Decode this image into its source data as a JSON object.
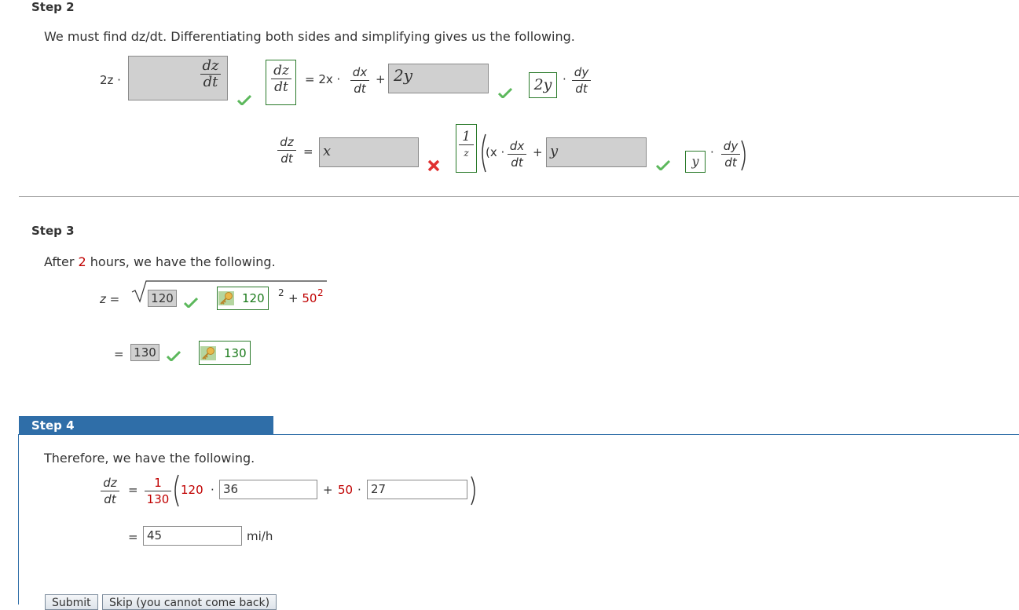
{
  "step2": {
    "label": "Step 2",
    "intro": "We must find dz/dt. Differentiating both sides and simplifying gives us the following.",
    "row1": {
      "coef_left": "2z ·",
      "box1_value": "dz/dt",
      "answer1_num": "dz",
      "answer1_den": "dt",
      "eq_mid": "= 2x ·",
      "dx_num": "dx",
      "dx_den": "dt",
      "plus": "+",
      "box2_value": "2y",
      "answer2": "2y",
      "dot": "·",
      "dy_num": "dy",
      "dy_den": "dt"
    },
    "row2": {
      "dz_num": "dz",
      "dz_den": "dt",
      "eq": "=",
      "box1_value": "x",
      "answer1_num": "1",
      "answer1_den": "z",
      "open": "(x ·",
      "dx_num": "dx",
      "dx_den": "dt",
      "plus": "+",
      "box2_value": "y",
      "answer2": "y",
      "dot": "·",
      "dy_num": "dy",
      "dy_den": "dt"
    }
  },
  "step3": {
    "label": "Step 3",
    "intro_before": "After ",
    "intro_hours": "2",
    "intro_after": " hours, we have the following.",
    "z_eq": "z =",
    "box1_value": "120",
    "answer1": "120",
    "sup2": "2",
    "plus50": "+ 50",
    "sup2b": "2",
    "eq2": "=",
    "box2_value": "130",
    "answer2": "130"
  },
  "step4": {
    "label": "Step 4",
    "intro": "Therefore, we have the following.",
    "dz_num": "dz",
    "dz_den": "dt",
    "eq": "=",
    "frac_num": "1",
    "frac_den": "130",
    "coef1": "120",
    "dot1": "·",
    "input1_value": "36",
    "plus": "+",
    "coef2": "50",
    "dot2": "·",
    "input2_value": "27",
    "eq2": "=",
    "input3_value": "45",
    "unit": "mi/h",
    "submit_label": "Submit",
    "skip_label": "Skip (you cannot come back)"
  },
  "colors": {
    "step4_tab": "#2f6ea8",
    "check": "#5cb85c",
    "cross": "#e03030"
  }
}
